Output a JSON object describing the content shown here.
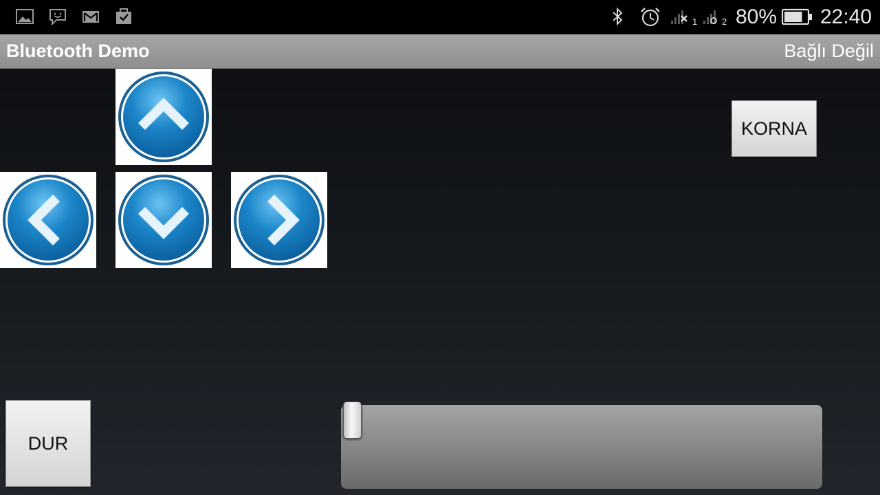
{
  "status_bar": {
    "notification_icons": [
      "image-icon",
      "chat-icon",
      "gmail-icon",
      "clipboard-check-icon"
    ],
    "system_icons": [
      "bluetooth-icon",
      "alarm-icon",
      "signal-sim1-icon",
      "signal-sim2-icon",
      "battery-icon"
    ],
    "sim1_label": "1",
    "sim2_label": "2",
    "battery_percent": "80%",
    "battery_level": 0.8,
    "time": "22:40"
  },
  "title_bar": {
    "app_title": "Bluetooth Demo",
    "connection_status": "Bağlı Değil"
  },
  "controls": {
    "direction_buttons": [
      "up",
      "left",
      "down",
      "right"
    ],
    "horn_label": "KORNA",
    "stop_label": "DUR",
    "speed_slider_value": 0
  },
  "colors": {
    "button_blue": "#1a78b8",
    "button_ring": "#1c5f92",
    "title_bar": "#9a9a9a",
    "status_bar": "#000000"
  }
}
